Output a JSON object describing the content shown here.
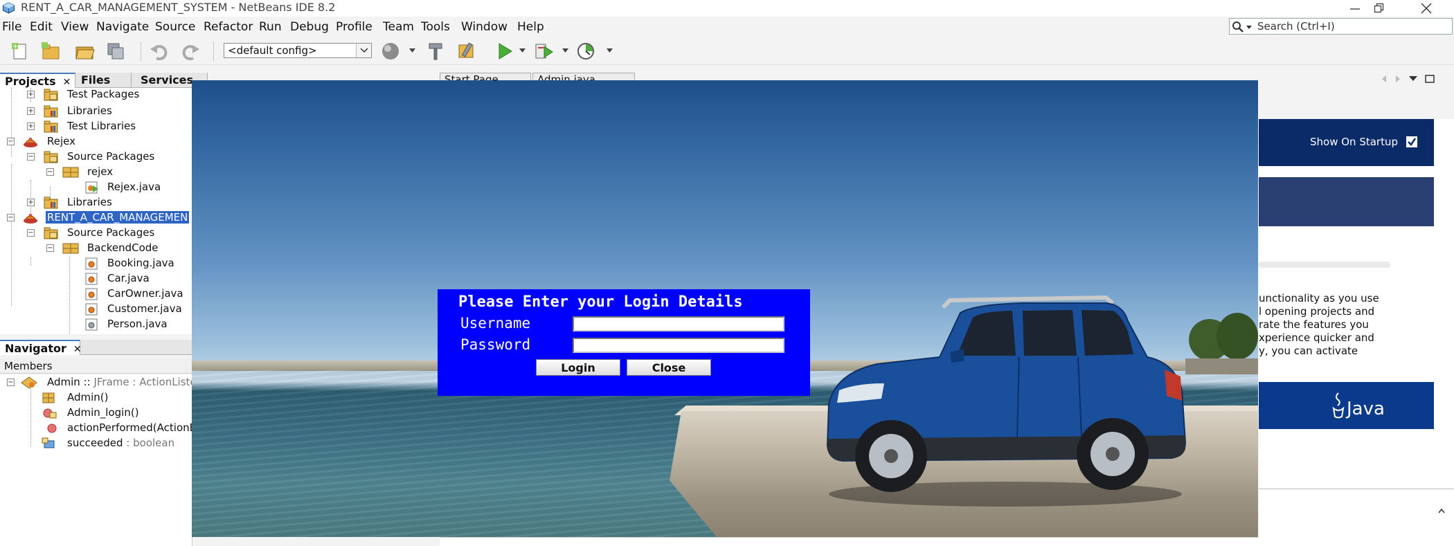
{
  "window": {
    "title": "RENT_A_CAR_MANAGEMENT_SYSTEM - NetBeans IDE 8.2"
  },
  "menu": [
    "File",
    "Edit",
    "View",
    "Navigate",
    "Source",
    "Refactor",
    "Run",
    "Debug",
    "Profile",
    "Team",
    "Tools",
    "Window",
    "Help"
  ],
  "search": {
    "placeholder": "Search (Ctrl+I)"
  },
  "toolbar": {
    "config": "<default config>"
  },
  "left_tabs": {
    "projects": "Projects",
    "files": "Files",
    "services": "Services"
  },
  "project_tree": {
    "test_packages": "Test Packages",
    "libraries_1": "Libraries",
    "test_libraries": "Test Libraries",
    "rejex": "Rejex",
    "source_packages_1": "Source Packages",
    "rejex_pkg": "rejex",
    "rejex_java": "Rejex.java",
    "libraries_2": "Libraries",
    "rent_project": "RENT_A_CAR_MANAGEMEN",
    "source_packages_2": "Source Packages",
    "backend_code": "BackendCode",
    "booking_java": "Booking.java",
    "car_java": "Car.java",
    "carowner_java": "CarOwner.java",
    "customer_java": "Customer.java",
    "person_java": "Person.java"
  },
  "navigator": {
    "tab": "Navigator",
    "members_label": "Members",
    "root_name": "Admin",
    "root_sep1": " :: ",
    "root_type": "JFrame : ActionListe",
    "items": {
      "constructor": "Admin()",
      "login_method": "Admin_login()",
      "action_method": "actionPerformed(ActionE",
      "field_name": "succeeded",
      "field_type": " : boolean"
    }
  },
  "editor_tabs": {
    "start_page": "Start Page",
    "admin_java": "Admin.java"
  },
  "start_page": {
    "show_on_startup": "Show On Startup",
    "text_lines": [
      "unctionality as you use",
      "l opening projects and",
      "rate the features you",
      "xperience quicker and",
      "y, you can activate"
    ],
    "java_label": "Java"
  },
  "login": {
    "title": "Please Enter your Login Details",
    "username_label": "Username",
    "password_label": "Password",
    "username_value": "",
    "password_value": "",
    "login_button": "Login",
    "close_button": "Close"
  },
  "colors": {
    "login_panel": "#0000ff",
    "selection": "#2f64c7",
    "start_page_band": "#0b2a68"
  }
}
